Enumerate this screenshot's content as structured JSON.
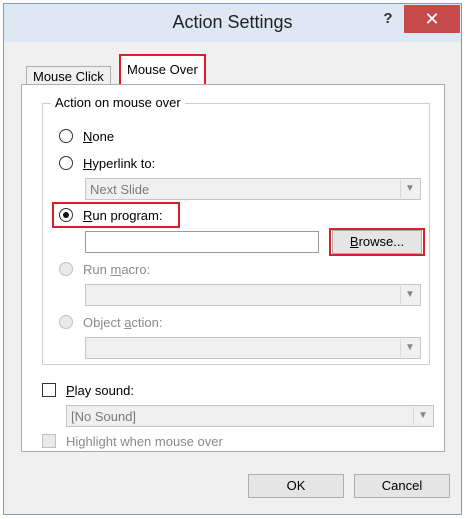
{
  "window": {
    "title": "Action Settings",
    "help_glyph": "?",
    "close_glyph": "✕"
  },
  "tabs": [
    {
      "label": "Mouse Click",
      "selected": false
    },
    {
      "label": "Mouse Over",
      "selected": true
    }
  ],
  "group": {
    "label": "Action on mouse over"
  },
  "options": {
    "none": {
      "label_u": "N",
      "label_rest": "one",
      "checked": false,
      "enabled": true
    },
    "hyperlink": {
      "label_u": "H",
      "label_rest": "yperlink to:",
      "checked": false,
      "enabled": true,
      "select_value": "Next Slide"
    },
    "run_program": {
      "label_u": "R",
      "label_rest": "un program:",
      "checked": true,
      "enabled": true,
      "input_value": "",
      "browse_label_u": "B",
      "browse_label_rest": "rowse..."
    },
    "run_macro": {
      "label_pre": "Run ",
      "label_u": "m",
      "label_rest": "acro:",
      "checked": false,
      "enabled": false,
      "select_value": ""
    },
    "object_action": {
      "label_pre": "Object ",
      "label_u": "a",
      "label_rest": "ction:",
      "checked": false,
      "enabled": false,
      "select_value": ""
    }
  },
  "play_sound": {
    "label_u": "P",
    "label_rest": "lay sound:",
    "checked": false,
    "select_value": "[No Sound]"
  },
  "highlight": {
    "label": "Highlight when mouse over",
    "checked": false,
    "enabled": false
  },
  "buttons": {
    "ok": "OK",
    "cancel": "Cancel"
  },
  "colors": {
    "highlight_border": "#d8202a",
    "close_button": "#c74a4a",
    "titlebar": "#dde8f4"
  },
  "icons": {
    "dropdown": "chevron-down-icon"
  }
}
